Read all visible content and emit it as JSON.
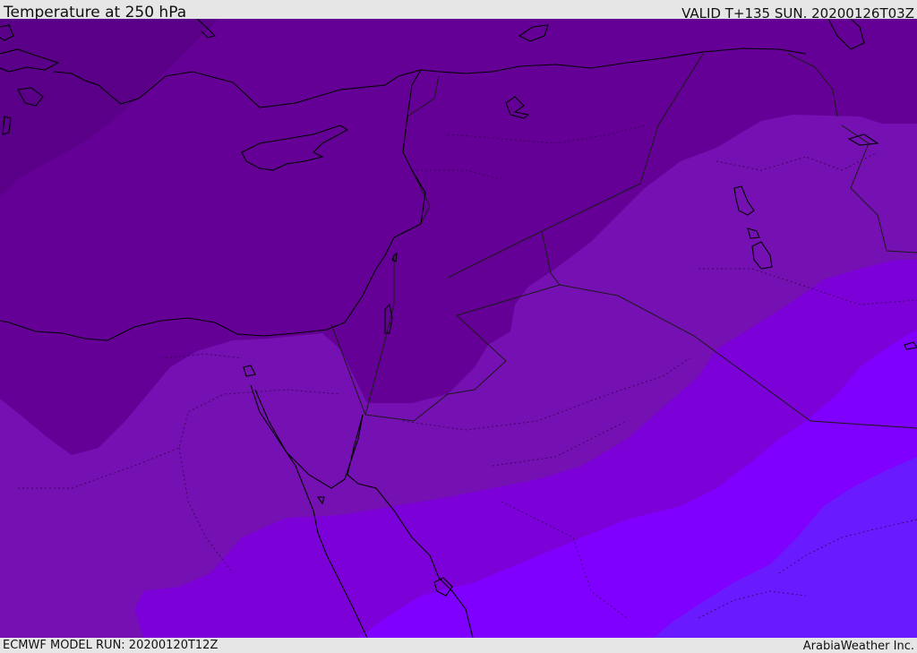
{
  "header": {
    "title": "Temperature at 250 hPa",
    "valid": "VALID T+135 SUN. 20200126T03Z"
  },
  "footer": {
    "model_run": "ECMWF MODEL RUN: 20200120T12Z",
    "credit": "ArabiaWeather Inc."
  },
  "map": {
    "colors": {
      "coldest_band": "#5a0088",
      "cold_band": "#650096",
      "mid_band": "#7510b2",
      "warm_band": "#7c00d8",
      "warmer_band": "#7f00ff",
      "warmest_band": "#6a1aff",
      "coastline": "#000000",
      "border": "#1a1a1a"
    }
  }
}
